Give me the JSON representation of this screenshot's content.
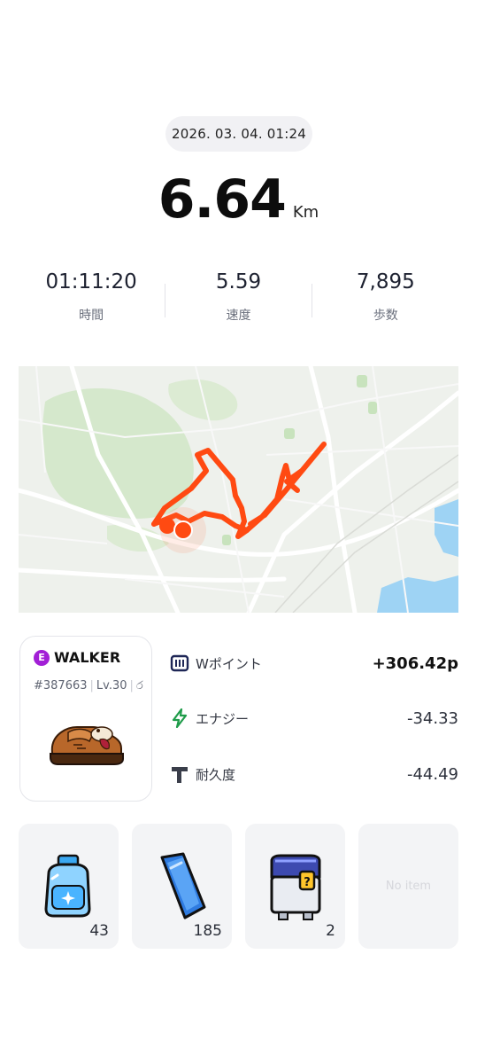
{
  "activity": {
    "date": "2026. 03. 04. 01:24",
    "distance": "6.64",
    "distance_unit": "Km"
  },
  "stats": [
    {
      "value": "01:11:20",
      "label": "時間"
    },
    {
      "value": "5.59",
      "label": "速度"
    },
    {
      "value": "7,895",
      "label": "歩数"
    }
  ],
  "walker": {
    "badge": "E",
    "name": "WALKER",
    "id": "#387663",
    "level": "Lv.30",
    "extra": "ර"
  },
  "rewards": [
    {
      "icon": "w-point-icon",
      "label": "Wポイント",
      "value": "+306.42p"
    },
    {
      "icon": "energy-bolt-icon",
      "label": "エナジー",
      "value": "-34.33"
    },
    {
      "icon": "durability-icon",
      "label": "耐久度",
      "value": "-44.49"
    }
  ],
  "items": [
    {
      "icon": "detergent-bottle-icon",
      "count": "43"
    },
    {
      "icon": "blue-gem-icon",
      "count": "185"
    },
    {
      "icon": "mystery-box-icon",
      "count": "2"
    },
    {
      "empty_label": "No item"
    }
  ],
  "colors": {
    "route": "#ff4a12",
    "walker_badge": "#a21fd6",
    "map_background": "#eef1ec",
    "map_water": "#9ed3f4",
    "map_park": "#d5e8cc"
  }
}
